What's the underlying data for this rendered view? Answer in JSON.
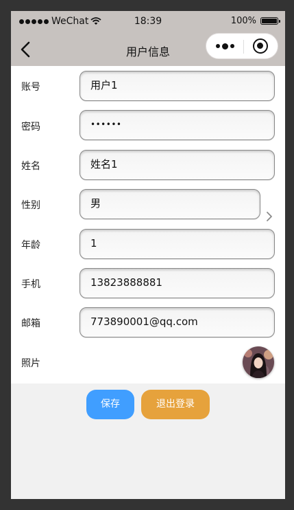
{
  "statusbar": {
    "carrier": "WeChat",
    "time": "18:39",
    "battery": "100%"
  },
  "navbar": {
    "title": "用户信息"
  },
  "form": {
    "account_label": "账号",
    "account_value": "用户1",
    "password_label": "密码",
    "password_value": "••••••",
    "name_label": "姓名",
    "name_value": "姓名1",
    "gender_label": "性别",
    "gender_value": "男",
    "age_label": "年龄",
    "age_value": "1",
    "phone_label": "手机",
    "phone_value": "13823888881",
    "email_label": "邮箱",
    "email_value": "773890001@qq.com",
    "photo_label": "照片"
  },
  "actions": {
    "save_label": "保存",
    "logout_label": "退出登录"
  },
  "colors": {
    "save": "#409eff",
    "logout": "#e6a23c",
    "bar": "#c7c2bf"
  },
  "icons": [
    "back-arrow-icon",
    "more-dots-icon",
    "capsule-close-icon",
    "wifi-icon",
    "battery-icon",
    "chevron-right-icon"
  ]
}
